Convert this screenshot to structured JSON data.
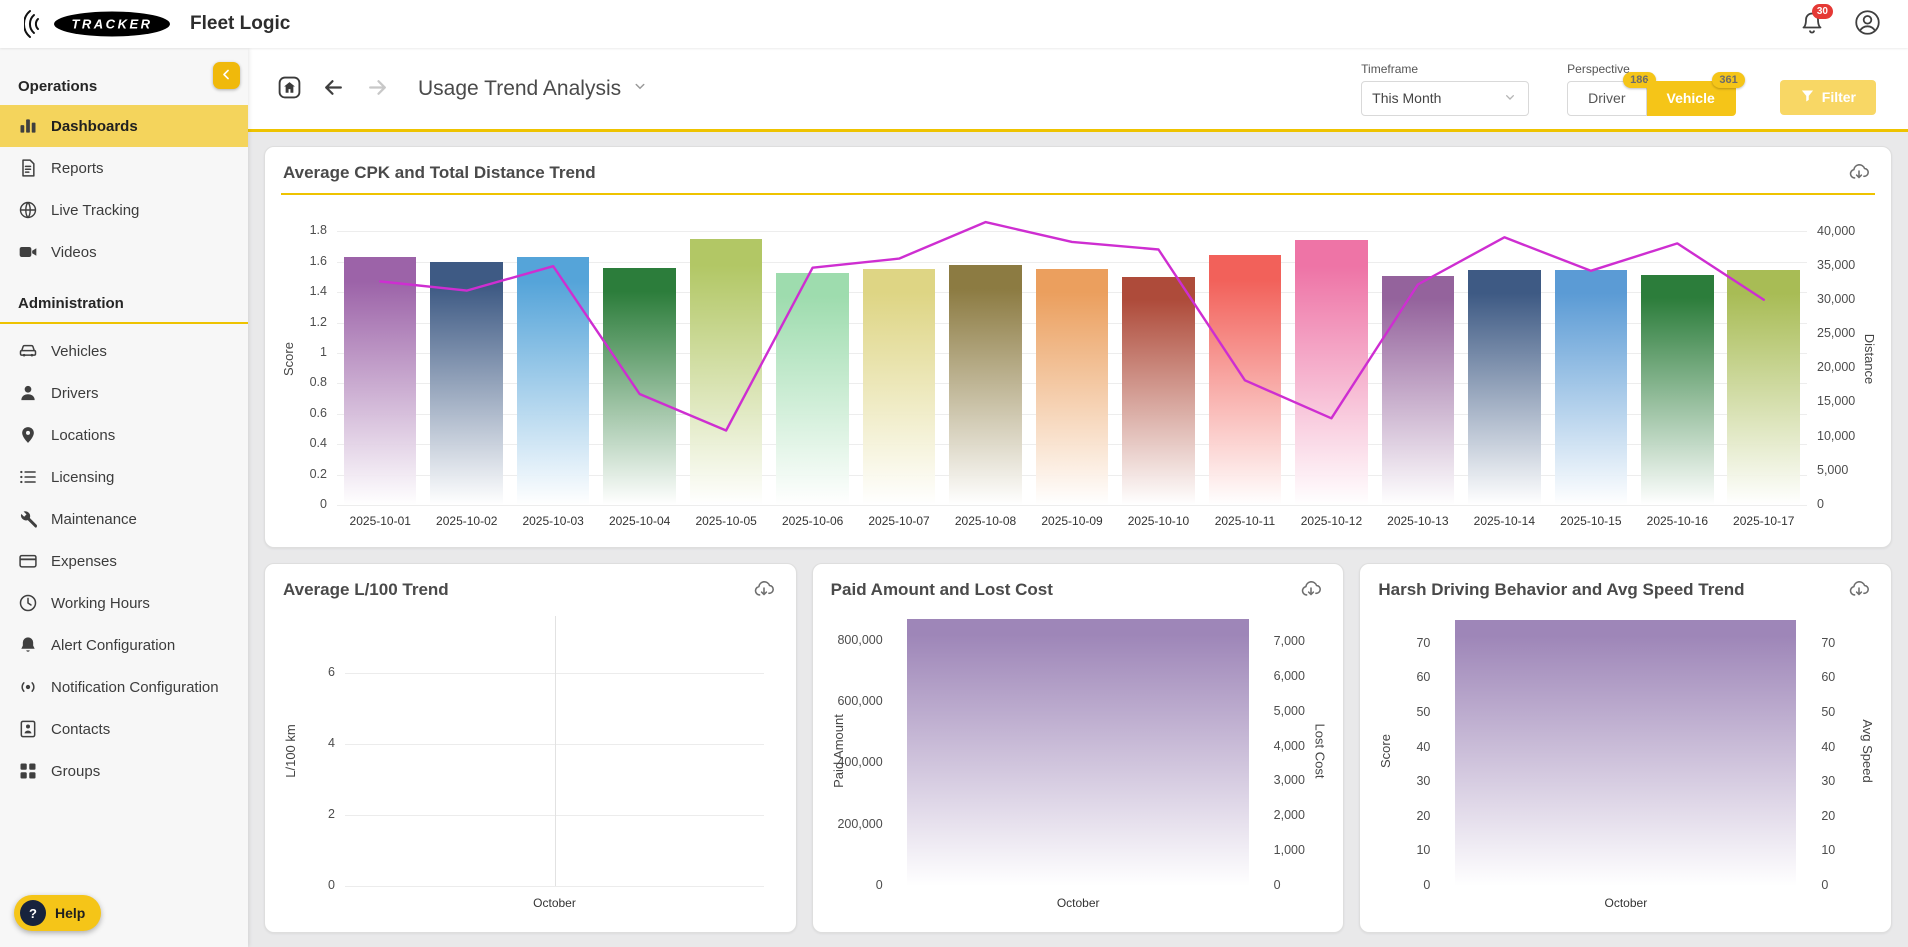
{
  "topbar": {
    "logo_text": "TRACKER",
    "app_name": "Fleet Logic",
    "notification_count": "30"
  },
  "icons": {
    "notifications": "bell-icon",
    "account": "user-circle-icon",
    "collapse": "chevron-left-icon",
    "home": "home-icon",
    "back": "arrow-left-icon",
    "forward": "arrow-right-icon",
    "title_caret": "chevron-down-icon",
    "select_caret": "chevron-down-icon",
    "filter": "funnel-icon",
    "card_action": "cloud-download-icon",
    "help": "question-icon"
  },
  "sidebar": {
    "sections": [
      {
        "title": "Operations",
        "items": [
          {
            "label": "Dashboards",
            "icon": "bar-chart",
            "active": true
          },
          {
            "label": "Reports",
            "icon": "report",
            "active": false
          },
          {
            "label": "Live Tracking",
            "icon": "globe",
            "active": false
          },
          {
            "label": "Videos",
            "icon": "video",
            "active": false
          }
        ]
      },
      {
        "title": "Administration",
        "items": [
          {
            "label": "Vehicles",
            "icon": "car",
            "active": false
          },
          {
            "label": "Drivers",
            "icon": "person",
            "active": false
          },
          {
            "label": "Locations",
            "icon": "pin",
            "active": false
          },
          {
            "label": "Licensing",
            "icon": "license",
            "active": false
          },
          {
            "label": "Maintenance",
            "icon": "wrench",
            "active": false
          },
          {
            "label": "Expenses",
            "icon": "card",
            "active": false
          },
          {
            "label": "Working Hours",
            "icon": "clock",
            "active": false
          },
          {
            "label": "Alert Configuration",
            "icon": "bell",
            "active": false
          },
          {
            "label": "Notification Configuration",
            "icon": "broadcast",
            "active": false
          },
          {
            "label": "Contacts",
            "icon": "contact",
            "active": false
          },
          {
            "label": "Groups",
            "icon": "groups",
            "active": false
          }
        ]
      }
    ],
    "help_label": "Help",
    "help_glyph": "?"
  },
  "header": {
    "title": "Usage Trend Analysis",
    "timeframe": {
      "label": "Timeframe",
      "value": "This Month"
    },
    "perspective": {
      "label": "Perspective",
      "options": [
        {
          "label": "Driver",
          "badge": "186",
          "selected": false
        },
        {
          "label": "Vehicle",
          "badge": "361",
          "selected": true
        }
      ]
    },
    "filter_label": "Filter"
  },
  "colors": {
    "accent": "#f5c518",
    "accent_dark": "#f0b90b",
    "active_item": "#f4d45c",
    "rule": "#eec300",
    "line": "#ce2ed1",
    "purple_bar": "#9e86b8",
    "badge_red": "#e53935"
  },
  "chart_data": [
    {
      "id": "cpk-distance",
      "type": "bar+line",
      "title": "Average CPK and Total Distance Trend",
      "legend_position": "none",
      "grid": true,
      "categories": [
        "2025-10-01",
        "2025-10-02",
        "2025-10-03",
        "2025-10-04",
        "2025-10-05",
        "2025-10-06",
        "2025-10-07",
        "2025-10-08",
        "2025-10-09",
        "2025-10-10",
        "2025-10-11",
        "2025-10-12",
        "2025-10-13",
        "2025-10-14",
        "2025-10-15",
        "2025-10-16",
        "2025-10-17"
      ],
      "series": [
        {
          "name": "Total Distance",
          "type": "bar",
          "axis": "right",
          "values": [
            36200,
            35600,
            36300,
            34600,
            38900,
            33900,
            34500,
            35100,
            34500,
            33300,
            36500,
            38700,
            33500,
            34400,
            34300,
            33700,
            34300
          ],
          "colors": [
            "#9c63a8",
            "#3e5a84",
            "#55a4d9",
            "#2c7d3b",
            "#b2c765",
            "#9edcae",
            "#ded584",
            "#8c7b42",
            "#eb9f5e",
            "#ae4b3a",
            "#f2615a",
            "#ee74a6",
            "#94639c",
            "#3e5a84",
            "#5b9bd5",
            "#2c7d3b",
            "#a8bc55"
          ]
        },
        {
          "name": "Average CPK",
          "type": "line",
          "axis": "left",
          "color": "#ce2ed1",
          "values": [
            1.47,
            1.41,
            1.57,
            0.73,
            0.49,
            1.56,
            1.62,
            1.86,
            1.73,
            1.68,
            0.82,
            0.57,
            1.45,
            1.76,
            1.54,
            1.72,
            1.35
          ]
        }
      ],
      "left_axis": {
        "label": "Score",
        "ticks": [
          0,
          0.2,
          0.4,
          0.6,
          0.8,
          1,
          1.2,
          1.4,
          1.6,
          1.8
        ],
        "tick_labels": [
          "0",
          "0.2",
          "0.4",
          "0.6",
          "0.8",
          "1",
          "1.2",
          "1.4",
          "1.6",
          "1.8"
        ],
        "max": 1.92
      },
      "right_axis": {
        "label": "Distance",
        "ticks": [
          0,
          5000,
          10000,
          15000,
          20000,
          25000,
          30000,
          35000,
          40000
        ],
        "tick_labels": [
          "0",
          "5,000",
          "10,000",
          "15,000",
          "20,000",
          "25,000",
          "30,000",
          "35,000",
          "40,000"
        ],
        "max": 42700
      }
    },
    {
      "id": "l100",
      "type": "line",
      "title": "Average L/100 Trend",
      "categories": [
        "October"
      ],
      "series": [],
      "left_axis": {
        "label": "L/100 km",
        "ticks": [
          0,
          2,
          4,
          6
        ],
        "tick_labels": [
          "0",
          "2",
          "4",
          "6"
        ],
        "max": 7.6
      },
      "xlabel": "October"
    },
    {
      "id": "paid-lost",
      "type": "bar",
      "title": "Paid Amount and Lost Cost",
      "categories": [
        "October"
      ],
      "series": [
        {
          "name": "Paid Amount",
          "axis": "left",
          "values": [
            870000
          ],
          "color": "#9e86b8"
        },
        {
          "name": "Lost Cost",
          "axis": "right",
          "values": [
            7650
          ],
          "color": "#9e86b8"
        }
      ],
      "left_axis": {
        "label": "Paid Amount",
        "ticks": [
          0,
          200000,
          400000,
          600000,
          800000
        ],
        "tick_labels": [
          "0",
          "200,000",
          "400,000",
          "600,000",
          "800,000"
        ],
        "max": 880000
      },
      "right_axis": {
        "label": "Lost Cost",
        "ticks": [
          0,
          1000,
          2000,
          3000,
          4000,
          5000,
          6000,
          7000
        ],
        "tick_labels": [
          "0",
          "1,000",
          "2,000",
          "3,000",
          "4,000",
          "5,000",
          "6,000",
          "7,000"
        ],
        "max": 7740
      },
      "xlabel": "October"
    },
    {
      "id": "harsh-speed",
      "type": "bar",
      "title": "Harsh Driving Behavior and Avg Speed Trend",
      "categories": [
        "October"
      ],
      "series": [
        {
          "name": "Score",
          "axis": "left",
          "values": [
            77
          ],
          "color": "#9e86b8"
        },
        {
          "name": "Avg Speed",
          "axis": "right",
          "values": [
            77
          ],
          "color": "#9e86b8"
        }
      ],
      "left_axis": {
        "label": "Score",
        "ticks": [
          0,
          10,
          20,
          30,
          40,
          50,
          60,
          70
        ],
        "tick_labels": [
          "0",
          "10",
          "20",
          "30",
          "40",
          "50",
          "60",
          "70"
        ],
        "max": 78
      },
      "right_axis": {
        "label": "Avg Speed",
        "ticks": [
          0,
          10,
          20,
          30,
          40,
          50,
          60,
          70
        ],
        "tick_labels": [
          "0",
          "10",
          "20",
          "30",
          "40",
          "50",
          "60",
          "70"
        ],
        "max": 78
      },
      "xlabel": "October"
    }
  ]
}
